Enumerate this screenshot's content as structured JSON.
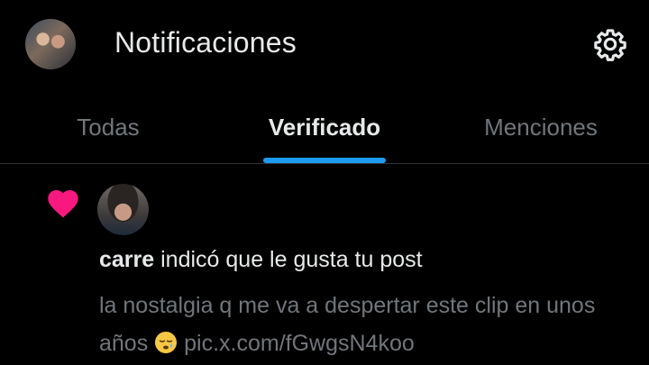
{
  "header": {
    "title": "Notificaciones",
    "settings_icon": "gear-icon"
  },
  "tabs": [
    {
      "label": "Todas",
      "active": false
    },
    {
      "label": "Verificado",
      "active": true
    },
    {
      "label": "Menciones",
      "active": false
    }
  ],
  "notification": {
    "type_icon": "heart-icon",
    "user": "carre",
    "action": " indicó que le gusta tu post",
    "preview_text": "la nostalgia q me va a despertar este clip en unos años",
    "emoji": "sleepy-face",
    "preview_link": "pic.x.com/fGwgsN4koo"
  },
  "colors": {
    "background": "#000000",
    "accent": "#1d9bf0",
    "like": "#f91880",
    "muted": "#71767b",
    "text": "#e7e9ea"
  }
}
